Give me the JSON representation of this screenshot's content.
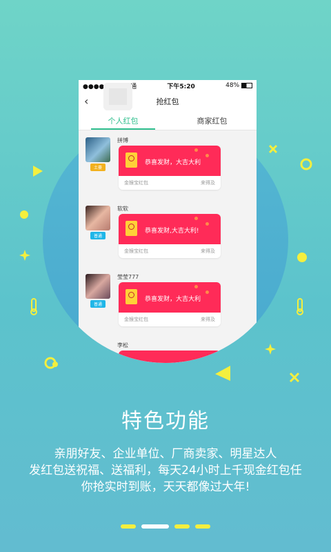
{
  "statusbar": {
    "carrier": "●●●●○ 中国联通",
    "time": "下午5:20",
    "battery": "48%"
  },
  "nav": {
    "title": "抢红包"
  },
  "tabs": [
    {
      "label": "个人红包",
      "active": true
    },
    {
      "label": "商家红包",
      "active": false
    }
  ],
  "items": [
    {
      "name": "拼博",
      "level": "土豪",
      "level_color": "#f2b11e",
      "message": "恭喜发财，大吉大利",
      "source": "金猴宝红包",
      "status": "来得及"
    },
    {
      "name": "软软",
      "level": "普通",
      "level_color": "#1fb6e8",
      "message": "恭喜发财,大吉大利!",
      "source": "金猴宝红包",
      "status": "来得及"
    },
    {
      "name": "莹莹777",
      "level": "普通",
      "level_color": "#1fb6e8",
      "message": "恭喜发财，大吉大利",
      "source": "金猴宝红包",
      "status": "来得及"
    },
    {
      "name": "李松"
    }
  ],
  "feature": {
    "title": "特色功能",
    "lines": [
      "亲朋好友、企业单位、厂商卖家、明星达人",
      "发红包送祝福、送福利，每天24小时上千现金红包任",
      "你抢实时到账，天天都像过大年!"
    ]
  },
  "colors": {
    "accent_green": "#2fbf8e",
    "red_packet": "#ff2b58",
    "page_indicator": "#f4ef3e"
  },
  "page_indicator": {
    "count": 4,
    "active_index": 1
  }
}
